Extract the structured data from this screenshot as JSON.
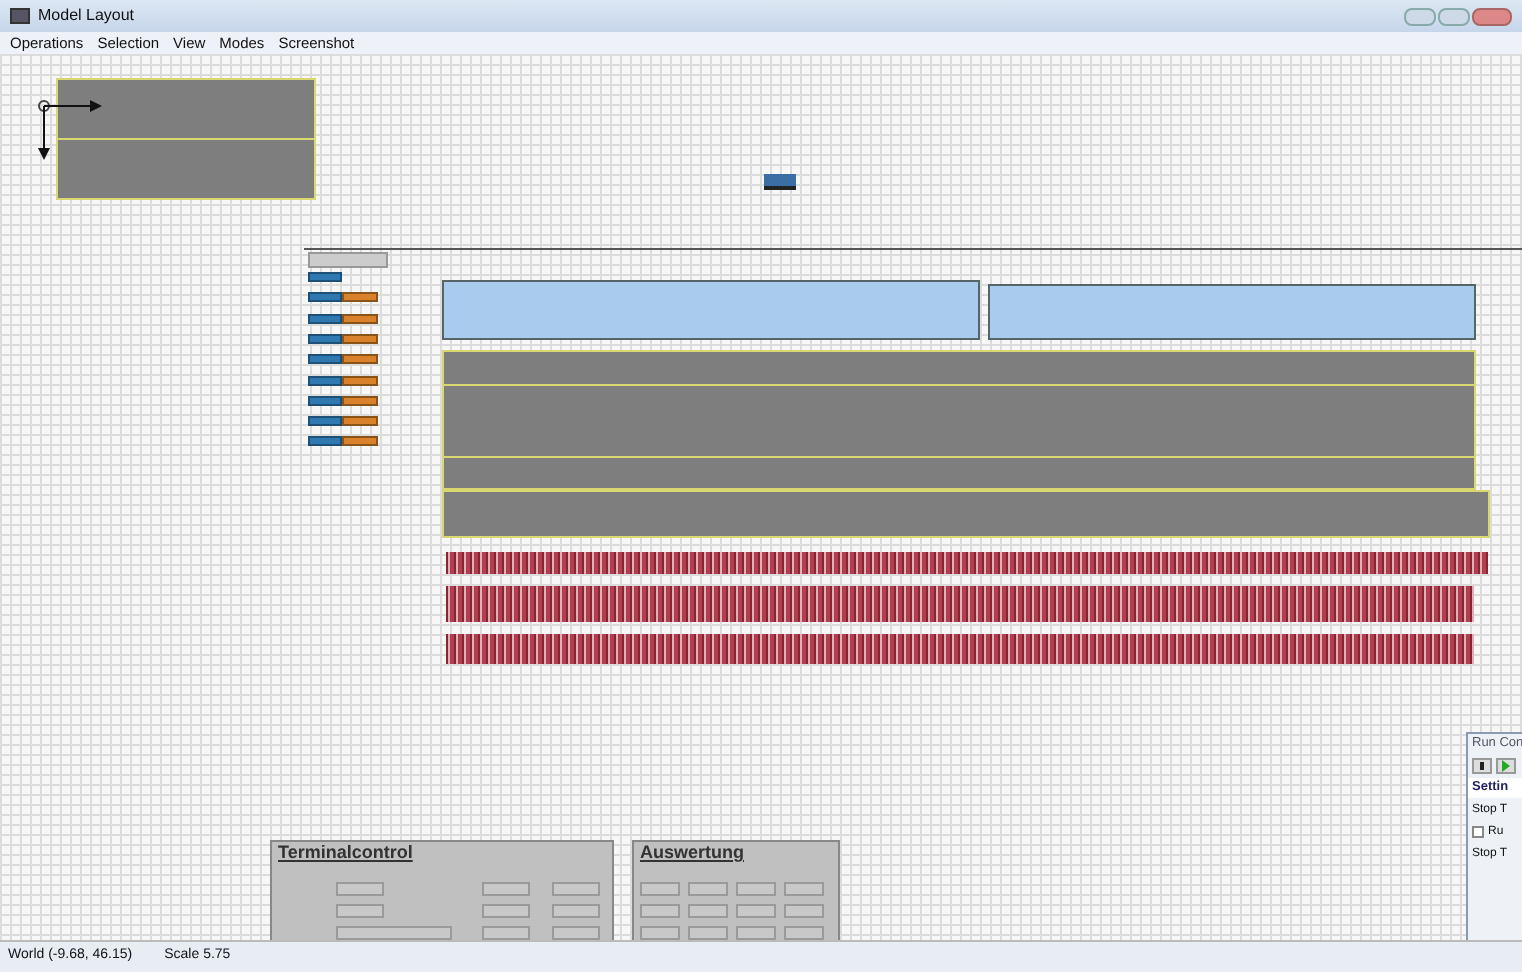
{
  "window": {
    "title": "Model Layout"
  },
  "menu": [
    {
      "label": "Operations"
    },
    {
      "label": "Selection"
    },
    {
      "label": "View"
    },
    {
      "label": "Modes"
    },
    {
      "label": "Screenshot"
    }
  ],
  "panels": [
    {
      "title": "Terminalcontrol"
    },
    {
      "title": "Auswertung"
    }
  ],
  "run_control": {
    "title": "Run Con",
    "tab": "Settin",
    "label_1": "Stop T",
    "checkbox": {
      "label": "Ru",
      "checked": false
    },
    "label_2": "Stop T"
  },
  "status_bar": {
    "world": "World (-9.68, 46.15)",
    "scale": "Scale 5.75"
  }
}
